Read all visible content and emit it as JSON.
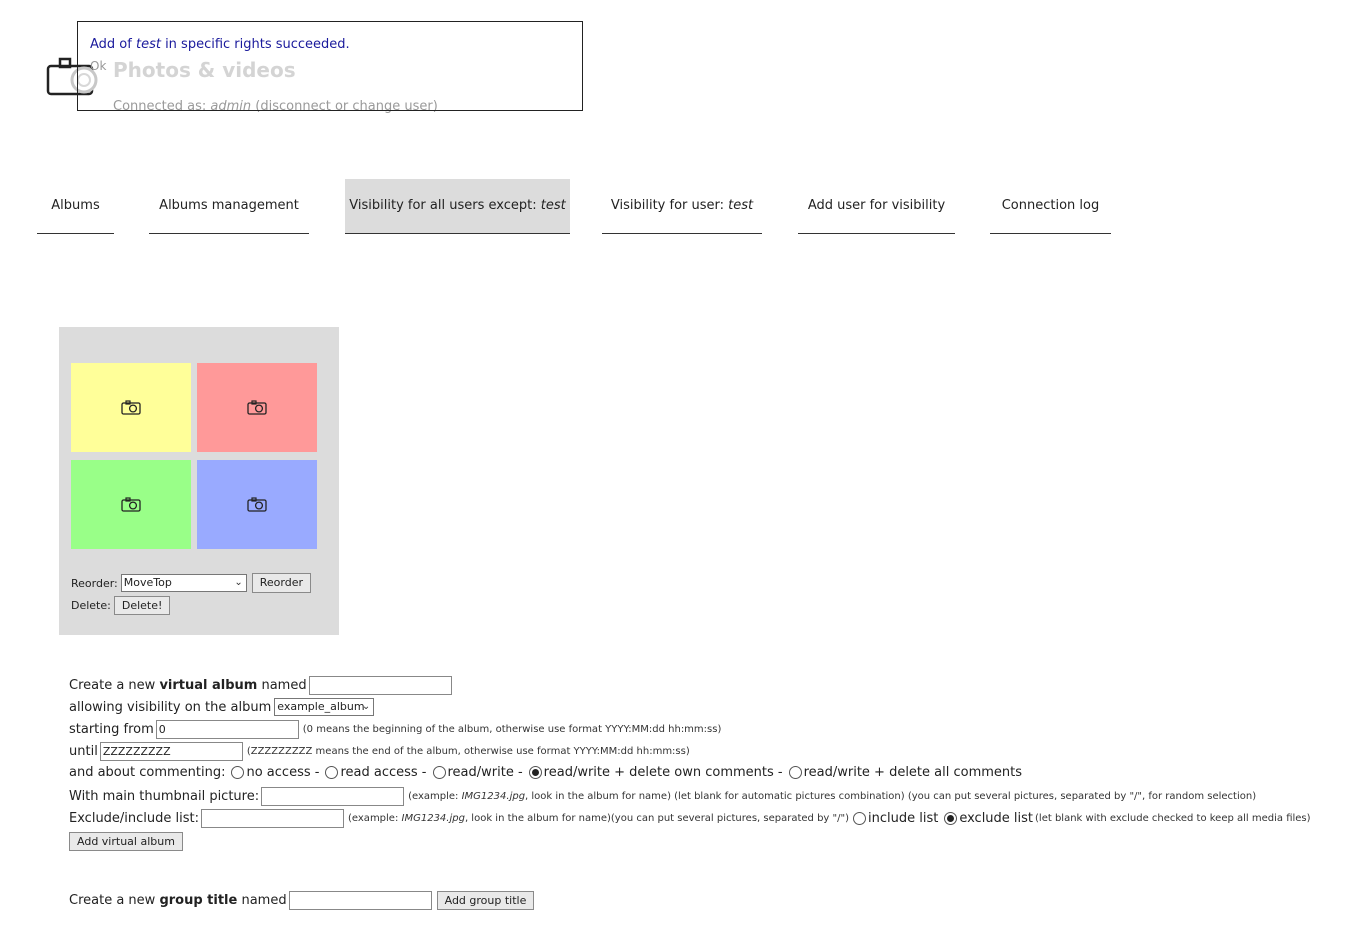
{
  "header": {
    "site_title": "Photos & videos",
    "connected_prefix": "Connected as:",
    "connected_user": "admin",
    "connected_suffix": "(disconnect or change user)"
  },
  "notification": {
    "msg_prefix": "Add of ",
    "msg_user": "test",
    "msg_suffix": " in specific rights succeeded.",
    "ok_label": "Ok"
  },
  "tabs": [
    {
      "label": "Albums"
    },
    {
      "label": "Albums management"
    },
    {
      "label": "Visibility for all users except: ",
      "user": "test",
      "active": true
    },
    {
      "label": "Visibility for user: ",
      "user": "test"
    },
    {
      "label": "Add user for visibility"
    },
    {
      "label": "Connection log"
    }
  ],
  "thumbnails": {
    "colors": [
      "#ffff99",
      "#ff9999",
      "#99ff88",
      "#99aaff"
    ],
    "icon": "camera-icon",
    "reorder_label": "Reorder:",
    "reorder_value": "MoveTop",
    "reorder_button": "Reorder",
    "delete_label": "Delete:",
    "delete_button": "Delete!"
  },
  "form": {
    "virtual_prefix": "Create a new ",
    "virtual_bold": "virtual album",
    "virtual_suffix": " named",
    "virtual_name_value": "",
    "allowing_label": "allowing visibility on the album",
    "album_select_value": "example_album",
    "starting_label": "starting from",
    "starting_value": "0",
    "starting_hint": "(0 means the beginning of the album, otherwise use format YYYY:MM:dd hh:mm:ss)",
    "until_label": "until",
    "until_value": "ZZZZZZZZZ",
    "until_hint": "(ZZZZZZZZZ means the end of the album, otherwise use format YYYY:MM:dd hh:mm:ss)",
    "commenting_label": "and about commenting:",
    "commenting_options": [
      {
        "label": "no access -",
        "checked": false
      },
      {
        "label": "read access -",
        "checked": false
      },
      {
        "label": "read/write -",
        "checked": false
      },
      {
        "label": "read/write + delete own comments -",
        "checked": true
      },
      {
        "label": "read/write + delete all comments",
        "checked": false
      }
    ],
    "thumbnail_label": "With main thumbnail picture:",
    "thumbnail_value": "",
    "thumbnail_hint_prefix": "(example: ",
    "thumbnail_hint_example": "IMG1234.jpg",
    "thumbnail_hint_suffix": ", look in the album for name) (let blank for automatic pictures combination) (you can put several pictures, separated by \"/\", for random selection)",
    "exclude_label": "Exclude/include list:",
    "exclude_value": "",
    "exclude_hint_prefix": "(example: ",
    "exclude_hint_example": "IMG1234.jpg",
    "exclude_hint_suffix": ", look in the album for name)(you can put several pictures, separated by \"/\")",
    "include_list_label": "include list",
    "include_checked": false,
    "exclude_list_label": "exclude list",
    "exclude_checked": true,
    "exclude_trailing_hint": "(let blank with exclude checked to keep all media files)",
    "add_virtual_button": "Add virtual album",
    "group_prefix": "Create a new ",
    "group_bold": "group title",
    "group_suffix": " named",
    "group_name_value": "",
    "add_group_button": "Add group title"
  }
}
